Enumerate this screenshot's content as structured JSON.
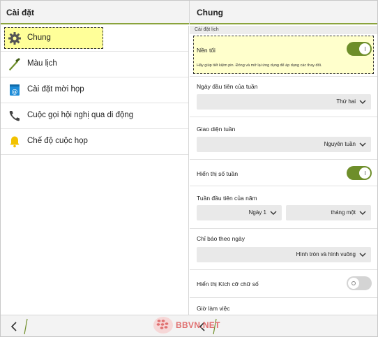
{
  "header": {
    "left_title": "Cài đặt",
    "right_title": "Chung"
  },
  "sidebar": {
    "items": [
      {
        "label": "Chung",
        "icon": "gear-icon",
        "selected": true
      },
      {
        "label": "Màu lịch",
        "icon": "color-picker-icon",
        "selected": false
      },
      {
        "label": "Cài đặt mời họp",
        "icon": "invite-at-icon",
        "selected": false
      },
      {
        "label": "Cuộc gọi hội nghị qua di động",
        "icon": "phone-icon",
        "selected": false
      },
      {
        "label": "Chế độ cuộc họp",
        "icon": "bell-icon",
        "selected": false
      }
    ]
  },
  "settings": {
    "section_title": "Cài đặt lịch",
    "dark_mode": {
      "label": "Nền tối",
      "description": "Hãy giúp tiết kiệm pin. Đóng và mở lại ứng dụng để áp dụng các thay đổi.",
      "enabled": true
    },
    "first_day_of_week": {
      "label": "Ngày đầu tiên của tuần",
      "value": "Thứ hai"
    },
    "week_view": {
      "label": "Giao diện tuần",
      "value": "Nguyên tuần"
    },
    "show_week_number": {
      "label": "Hiển thị số tuần",
      "enabled": true
    },
    "first_week_of_year": {
      "label": "Tuần đầu tiên của năm",
      "day_value": "Ngày 1",
      "month_value": "tháng một"
    },
    "day_indicator": {
      "label": "Chỉ báo theo ngày",
      "value": "Hình tròn và hình vuông"
    },
    "show_number_size": {
      "label": "Hiển thị Kích cỡ chữ số",
      "enabled": false
    },
    "working_hours": {
      "label": "Giờ làm việc"
    }
  },
  "bottom_bar": {
    "watermark": "BBVN.NET"
  },
  "colors": {
    "accent": "#6e8e2a",
    "highlight": "#ffff99"
  }
}
